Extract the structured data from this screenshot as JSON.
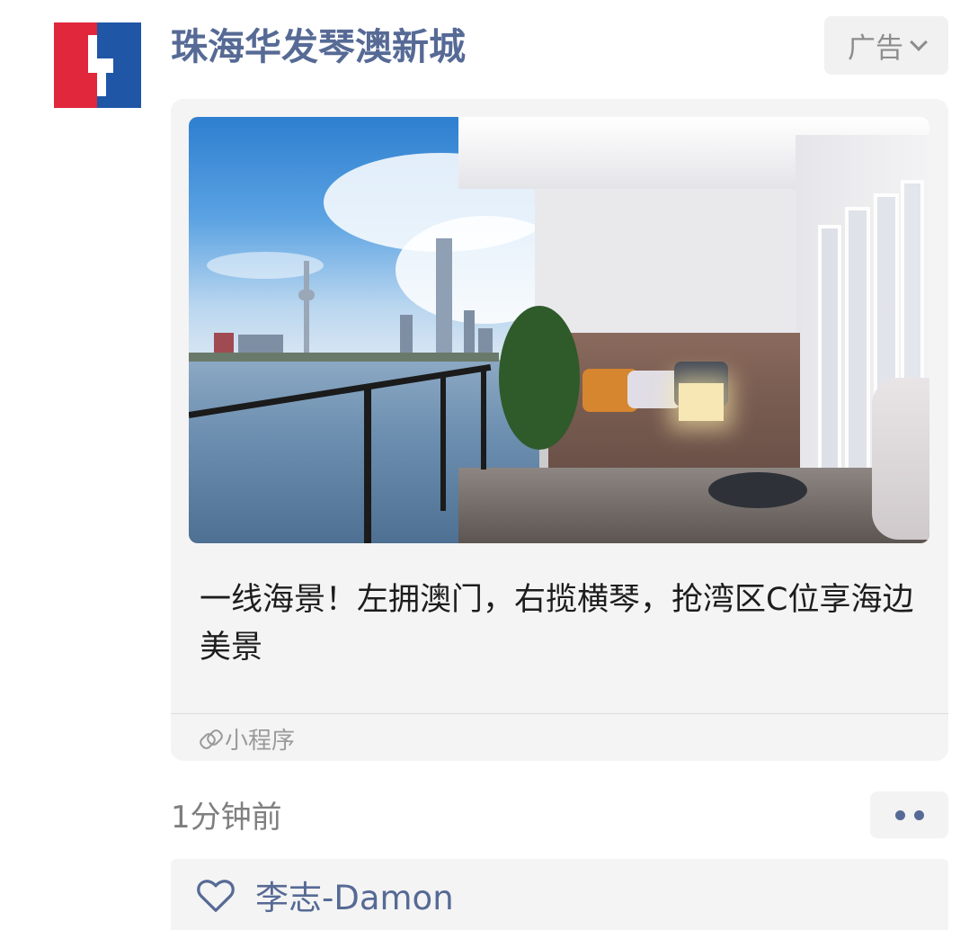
{
  "post": {
    "author": "珠海华发琴澳新城",
    "ad_label": "广告",
    "caption": "一线海景！左拥澳门，右揽横琴，抢湾区C位享海边美景",
    "mini_program_label": "小程序",
    "timestamp": "1分钟前",
    "likes": [
      "李志-Damon"
    ]
  },
  "icons": {
    "avatar": "brand-logo-red-blue",
    "ad_menu": "chevron-down-icon",
    "mini_program": "link-icon",
    "more": "more-dots-icon",
    "like": "heart-outline-icon"
  },
  "colors": {
    "link_blue": "#566a95",
    "logo_red": "#e0273c",
    "logo_blue": "#1f56a5",
    "card_bg": "#f4f4f4",
    "meta_gray": "#7f7f7f"
  }
}
